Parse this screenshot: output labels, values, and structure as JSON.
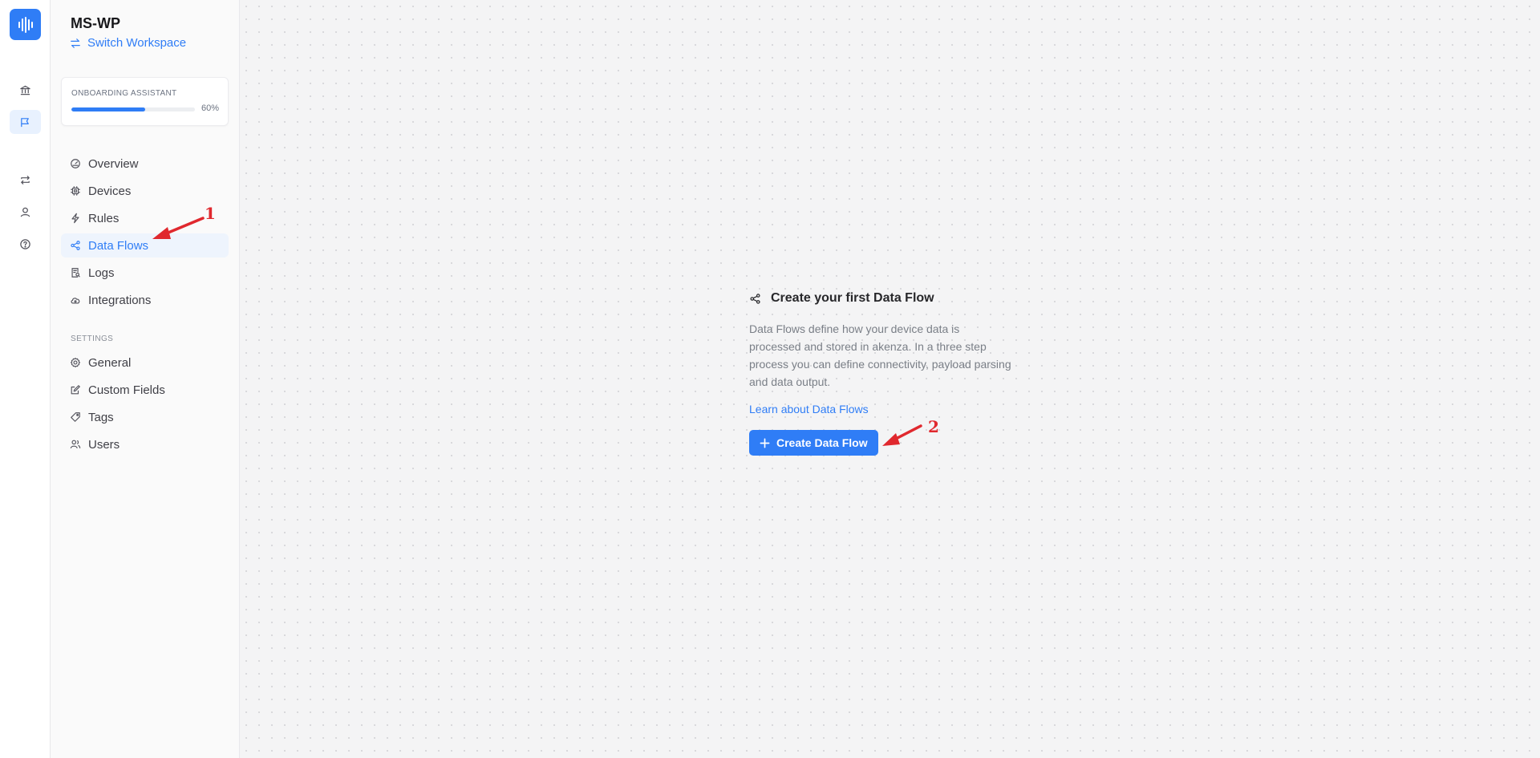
{
  "workspace": {
    "name": "MS-WP",
    "switch_label": "Switch Workspace"
  },
  "onboarding": {
    "label": "ONBOARDING ASSISTANT",
    "progress_percent": 60,
    "progress_text": "60%"
  },
  "nav": {
    "items": [
      {
        "label": "Overview",
        "icon": "gauge-icon"
      },
      {
        "label": "Devices",
        "icon": "chip-icon"
      },
      {
        "label": "Rules",
        "icon": "bolt-icon"
      },
      {
        "label": "Data Flows",
        "icon": "share-icon",
        "active": true
      },
      {
        "label": "Logs",
        "icon": "log-icon"
      },
      {
        "label": "Integrations",
        "icon": "cloud-icon"
      }
    ]
  },
  "settings": {
    "label": "SETTINGS",
    "items": [
      {
        "label": "General",
        "icon": "gear-icon"
      },
      {
        "label": "Custom Fields",
        "icon": "edit-icon"
      },
      {
        "label": "Tags",
        "icon": "tag-icon"
      },
      {
        "label": "Users",
        "icon": "users-icon"
      }
    ]
  },
  "rail": {
    "icons": [
      "bank-icon",
      "flag-icon",
      "swap-icon",
      "user-icon",
      "help-icon"
    ],
    "active": "flag-icon"
  },
  "empty_state": {
    "title": "Create your first Data Flow",
    "description": "Data Flows define how your device data is processed and stored in akenza. In a three step process you can define connectivity, payload parsing and data output.",
    "link": "Learn about Data Flows",
    "button": "Create Data Flow"
  },
  "annotations": {
    "step1": "1",
    "step2": "2"
  },
  "colors": {
    "accent": "#2f7df6",
    "annotation": "#e0282e"
  }
}
